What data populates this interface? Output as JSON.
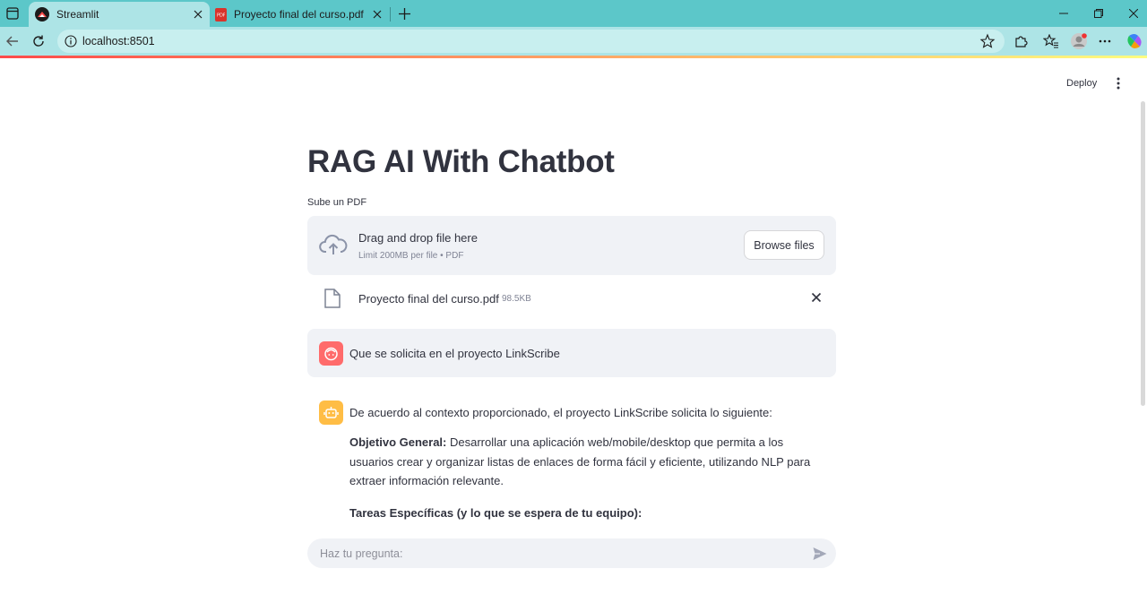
{
  "browser": {
    "tabs": [
      {
        "title": "Streamlit",
        "favicon": "streamlit-icon",
        "active": true
      },
      {
        "title": "Proyecto final del curso.pdf",
        "favicon": "pdf-icon",
        "active": false
      }
    ],
    "url": "localhost:8501"
  },
  "header": {
    "deploy_label": "Deploy"
  },
  "page": {
    "title": "RAG AI With Chatbot"
  },
  "uploader": {
    "label": "Sube un PDF",
    "drop_text": "Drag and drop file here",
    "limit_text": "Limit 200MB per file • PDF",
    "browse_label": "Browse files",
    "file": {
      "name": "Proyecto final del curso.pdf",
      "size": "98.5KB"
    }
  },
  "chat": {
    "user_message": "Que se solicita en el proyecto LinkScribe",
    "assistant": {
      "intro": "De acuerdo al contexto proporcionado, el proyecto LinkScribe solicita lo siguiente:",
      "objective_label": "Objetivo General:",
      "objective_text": " Desarrollar una aplicación web/mobile/desktop que permita a los usuarios crear y organizar listas de enlaces de forma fácil y eficiente, utilizando NLP para extraer información relevante.",
      "tasks_heading": "Tareas Específicas (y lo que se espera de tu equipo):"
    },
    "input_placeholder": "Haz tu pregunta:"
  },
  "colors": {
    "tabbar": "#5cc7c9",
    "toolbar": "#ade4e6",
    "text": "#31333f",
    "secondary_bg": "#f0f2f6",
    "user_avatar": "#ff6b6b",
    "assistant_avatar": "#ffbd45"
  }
}
